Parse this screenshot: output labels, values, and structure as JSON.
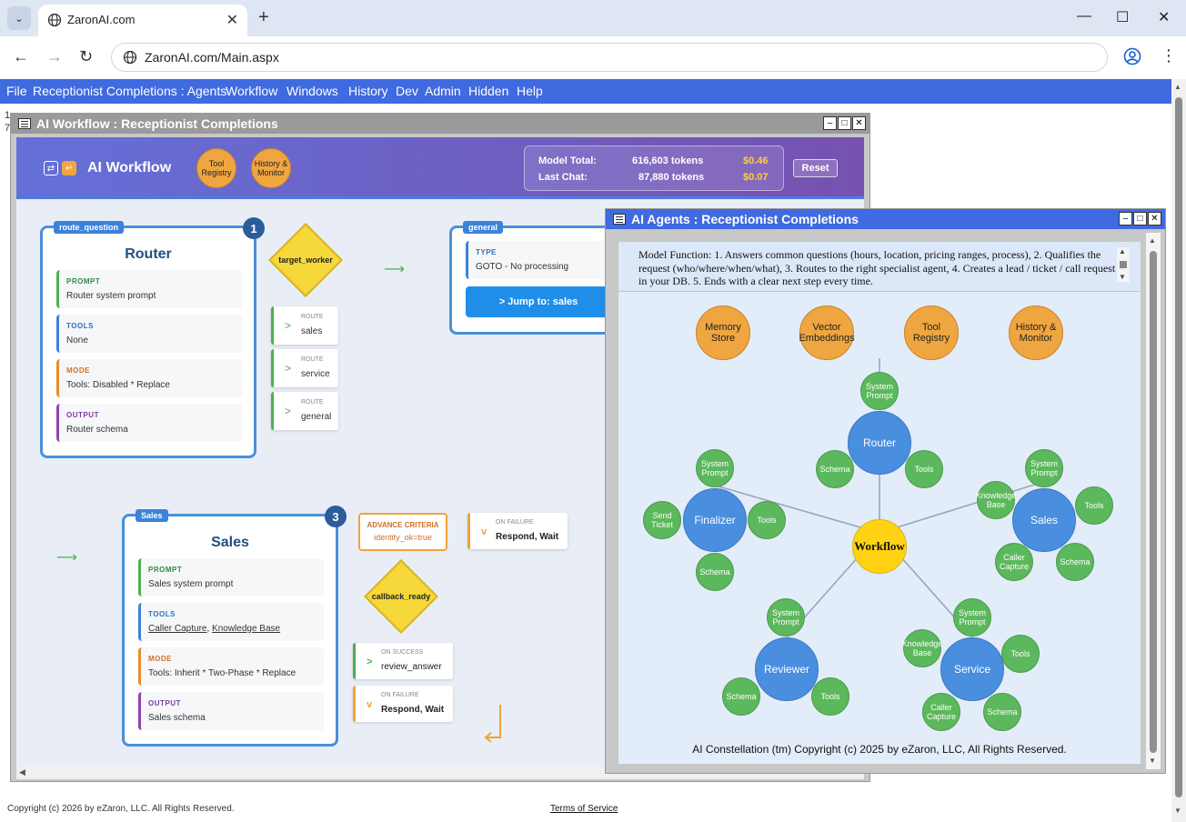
{
  "browser": {
    "tab_title": "ZaronAI.com",
    "url": "ZaronAI.com/Main.aspx",
    "icons": [
      "chevron-down-icon",
      "globe-icon",
      "close-icon",
      "plus-icon",
      "minimize-icon",
      "maximize-icon",
      "close-window-icon",
      "back-icon",
      "forward-icon",
      "reload-icon",
      "profile-icon",
      "kebab-menu-icon"
    ]
  },
  "menu": [
    "File",
    "Receptionist Completions : Agents",
    "Workflow",
    "Windows",
    "History",
    "Dev",
    "Admin",
    "Hidden",
    "Help"
  ],
  "left_digits": [
    "1",
    "7"
  ],
  "workflow_window": {
    "title": "AI Workflow : Receptionist Completions",
    "header_title": "AI Workflow",
    "tool_registry": "Tool Registry",
    "history_monitor": "History & Monitor",
    "model_total_label": "Model Total:",
    "model_total_tokens": "616,603 tokens",
    "model_total_cost": "$0.46",
    "last_chat_label": "Last Chat:",
    "last_chat_tokens": "87,880 tokens",
    "last_chat_cost": "$0.07",
    "reset": "Reset",
    "router": {
      "tag": "route_question",
      "num": "1",
      "title": "Router",
      "prompt_lbl": "PROMPT",
      "prompt": "Router system prompt",
      "tools_lbl": "TOOLS",
      "tools": "None",
      "mode_lbl": "MODE",
      "mode": "Tools: Disabled * Replace",
      "output_lbl": "OUTPUT",
      "output": "Router schema"
    },
    "decision1": "target_worker",
    "routes": [
      {
        "label": "ROUTE",
        "value": "sales"
      },
      {
        "label": "ROUTE",
        "value": "service"
      },
      {
        "label": "ROUTE",
        "value": "general"
      }
    ],
    "general": {
      "tag": "general",
      "type_lbl": "TYPE",
      "type": "GOTO - No processing",
      "jump": "> Jump to: sales"
    },
    "sales": {
      "tag": "Sales",
      "num": "3",
      "title": "Sales",
      "prompt_lbl": "PROMPT",
      "prompt": "Sales system prompt",
      "tools_lbl": "TOOLS",
      "tool1": "Caller Capture",
      "tool_sep": ", ",
      "tool2": "Knowledge Base",
      "mode_lbl": "MODE",
      "mode": "Tools: Inherit * Two-Phase * Replace",
      "output_lbl": "OUTPUT",
      "output": "Sales schema"
    },
    "advance_lbl": "ADVANCE CRITERIA",
    "advance_val": "identity_ok=true",
    "decision2": "callback_ready",
    "on_failure1": {
      "icon": "v",
      "label": "ON FAILURE",
      "value": "Respond, Wait"
    },
    "on_success": {
      "icon": ">",
      "label": "ON SUCCESS",
      "value": "review_answer"
    },
    "on_failure2": {
      "icon": "v",
      "label": "ON FAILURE",
      "value": "Respond, Wait"
    }
  },
  "agents_window": {
    "title": "AI Agents : Receptionist Completions",
    "model_function": "Model Function: 1. Answers common questions (hours, location, pricing ranges, process), 2. Qualifies the request (who/where/when/what), 3. Routes to the right specialist agent, 4. Creates a lead / ticket / call request in your DB. 5. Ends with a clear next step every time.",
    "top_orbs": [
      "Memory Store",
      "Vector Embeddings",
      "Tool Registry",
      "History & Monitor"
    ],
    "hub": "Workflow",
    "agents": [
      "Router",
      "Finalizer",
      "Sales",
      "Reviewer",
      "Service"
    ],
    "subs": {
      "router": [
        "System Prompt",
        "Schema",
        "Tools"
      ],
      "finalizer": [
        "System Prompt",
        "Send Ticket",
        "Tools",
        "Schema"
      ],
      "sales": [
        "System Prompt",
        "Knowledge Base",
        "Tools",
        "Caller Capture",
        "Schema"
      ],
      "reviewer": [
        "System Prompt",
        "Schema",
        "Tools"
      ],
      "service": [
        "System Prompt",
        "Knowledge Base",
        "Tools",
        "Caller Capture",
        "Schema"
      ]
    },
    "copyright": "AI Constellation (tm) Copyright (c) 2025 by eZaron, LLC, All Rights Reserved."
  },
  "footer": {
    "copyright": "Copyright (c) 2026 by eZaron, LLC. All Rights Reserved.",
    "terms": "Terms of Service"
  },
  "colors": {
    "menu": "#3f6ae0",
    "agent": "#4a8ee0",
    "sub": "#5cb85c",
    "hub": "#ffd313",
    "orb": "#f0a640"
  }
}
